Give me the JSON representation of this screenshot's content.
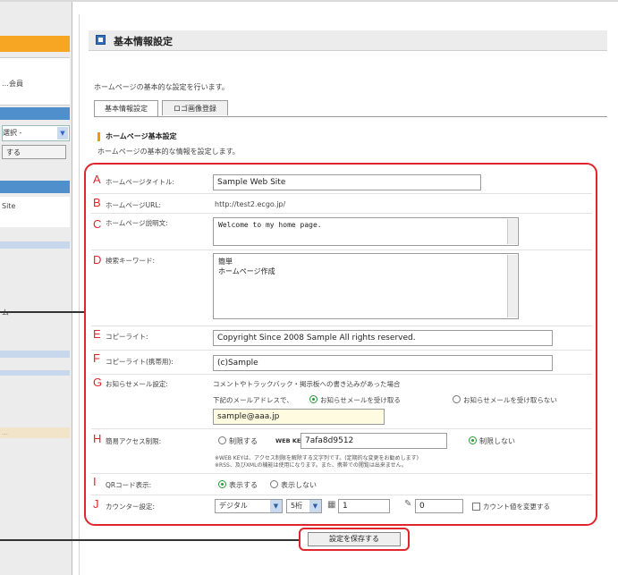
{
  "colors": {
    "accent_red": "#e0262c",
    "sidebar_orange": "#f6a623",
    "sidebar_blue": "#4f8fcc",
    "title_icon": "#2e6fc0",
    "radio_on": "#2a9a3a"
  },
  "sidebar": {
    "text1": "…会員",
    "select_value": "選択 -",
    "button_label": "する",
    "text2": "Site",
    "text3": "ム",
    "text4": "…"
  },
  "page": {
    "title": "基本情報設定",
    "intro": "ホームページの基本的な設定を行います。",
    "tabs": [
      {
        "label": "基本情報設定"
      },
      {
        "label": "ロゴ画像登録"
      }
    ],
    "section_title": "ホームページ基本設定",
    "section_sub": "ホームページの基本的な情報を設定します。"
  },
  "form": {
    "A": {
      "letter": "A",
      "label": "ホームページタイトル:",
      "value": "Sample Web Site"
    },
    "B": {
      "letter": "B",
      "label": "ホームページURL:",
      "value": "http://test2.ecgo.jp/"
    },
    "C": {
      "letter": "C",
      "label": "ホームページ説明文:",
      "value": "Welcome to my home page."
    },
    "D": {
      "letter": "D",
      "label": "検索キーワード:",
      "value": "簡単\nホームページ作成"
    },
    "E": {
      "letter": "E",
      "label": "コピーライト:",
      "value": "Copyright Since 2008 Sample All rights reserved."
    },
    "F": {
      "letter": "F",
      "label": "コピーライト(携帯用):",
      "value": "(c)Sample"
    },
    "G": {
      "letter": "G",
      "label": "お知らせメール設定:",
      "desc": "コメントやトラックバック・掲示板への書き込みがあった場合",
      "prompt": "下記のメールアドレスで、",
      "opt_receive": "お知らせメールを受け取る",
      "opt_noreceive": "お知らせメールを受け取らない",
      "email": "sample@aaa.jp"
    },
    "H": {
      "letter": "H",
      "label": "簡易アクセス制限:",
      "opt_restrict": "制限する",
      "key_label": "WEB KEY:",
      "key_value": "7afa8d9512",
      "opt_norestrict": "制限しない",
      "note1": "※WEB KEYは、アクセス制限を解除する文字列です。(定期的な変更をお勧めします)",
      "note2": "※RSS、及びXMLの機能は使用になります。また、携帯での閲覧は出来ません。"
    },
    "I": {
      "letter": "I",
      "label": "QRコード表示:",
      "opt_show": "表示する",
      "opt_hide": "表示しない"
    },
    "J": {
      "letter": "J",
      "label": "カウンター設定:",
      "type_value": "デジタル",
      "digits_value": "5桁",
      "count_value": "1",
      "count2_value": "0",
      "change_label": "カウント値を変更する"
    }
  },
  "save_button_label": "設定を保存する"
}
